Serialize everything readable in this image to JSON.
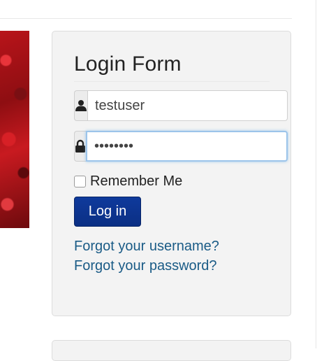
{
  "login_module": {
    "title": "Login Form",
    "username": {
      "value": "testuser",
      "icon": "user-icon"
    },
    "password": {
      "value": "testpass",
      "icon": "lock-icon"
    },
    "remember_label": "Remember Me",
    "remember_checked": false,
    "submit_label": "Log in",
    "forgot_username": "Forgot your username?",
    "forgot_password": "Forgot your password?"
  },
  "colors": {
    "button": "#0b2f84",
    "link": "#1a5b86",
    "focus": "#9cc4ea"
  }
}
